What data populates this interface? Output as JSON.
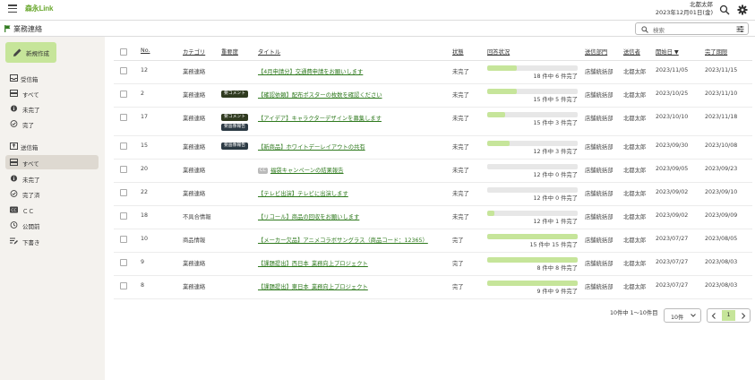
{
  "header": {
    "logo": "森永Link",
    "user_name": "北都太郎",
    "date": "2023年12月01日(金)"
  },
  "title_bar": {
    "title": "業務連絡",
    "search_placeholder": "検索"
  },
  "sidebar": {
    "new_button": "新規作成",
    "received": {
      "label": "受信箱",
      "items": [
        "すべて",
        "未完了",
        "完了"
      ]
    },
    "sent": {
      "label": "送信箱",
      "items": [
        "すべて",
        "未完了",
        "完了済",
        "ＣＣ",
        "公開前",
        "下書き"
      ]
    }
  },
  "table": {
    "headers": [
      "No.",
      "カテゴリ",
      "重要度",
      "タイトル",
      "状態",
      "回答状況",
      "送信部門",
      "送信者",
      "開始日 ▼",
      "完了期限"
    ],
    "rows": [
      {
        "no": "12",
        "category": "業務連絡",
        "badges": [],
        "cc": false,
        "title": "【4月申請分】交通費申請をお願いします",
        "status": "未完了",
        "progress_text": "18 件中 6 件完了",
        "progress": 0.33,
        "dept": "店舗統括部",
        "sender": "北都太郎",
        "start": "2023/11/05",
        "due": "2023/11/15"
      },
      {
        "no": "2",
        "category": "業務連絡",
        "badges": [
          "要コメント"
        ],
        "cc": false,
        "title": "【確認依頼】配布ポスターの枚数を確認ください",
        "status": "未完了",
        "progress_text": "15 件中 5 件完了",
        "progress": 0.33,
        "dept": "店舗統括部",
        "sender": "北都太郎",
        "start": "2023/10/25",
        "due": "2023/11/10"
      },
      {
        "no": "17",
        "category": "業務連絡",
        "badges": [
          "要コメント",
          "要画像報告"
        ],
        "cc": false,
        "title": "【アイデア】キャラクターデザインを募集します",
        "status": "未完了",
        "progress_text": "15 件中 3 件完了",
        "progress": 0.2,
        "dept": "店舗統括部",
        "sender": "北都太郎",
        "start": "2023/10/10",
        "due": "2023/11/18"
      },
      {
        "no": "15",
        "category": "業務連絡",
        "badges": [
          "要画像報告"
        ],
        "cc": false,
        "title": "【新商品】ホワイトデーレイアウトの共有",
        "status": "未完了",
        "progress_text": "12 件中 3 件完了",
        "progress": 0.25,
        "dept": "店舗統括部",
        "sender": "北都太郎",
        "start": "2023/09/30",
        "due": "2023/10/08"
      },
      {
        "no": "20",
        "category": "業務連絡",
        "badges": [],
        "cc": true,
        "title": "福袋キャンペーンの結果報告",
        "status": "未完了",
        "progress_text": "12 件中 0 件完了",
        "progress": 0.0,
        "dept": "店舗統括部",
        "sender": "北都太郎",
        "start": "2023/09/05",
        "due": "2023/09/23"
      },
      {
        "no": "22",
        "category": "業務連絡",
        "badges": [],
        "cc": false,
        "title": "【テレビ出演】テレビに出演します",
        "status": "未完了",
        "progress_text": "12 件中 0 件完了",
        "progress": 0.0,
        "dept": "店舗統括部",
        "sender": "北都太郎",
        "start": "2023/09/02",
        "due": "2023/09/10"
      },
      {
        "no": "18",
        "category": "不具合情報",
        "badges": [],
        "cc": false,
        "title": "【リコール】商品の回収をお願いします",
        "status": "未完了",
        "progress_text": "12 件中 1 件完了",
        "progress": 0.08,
        "dept": "店舗統括部",
        "sender": "北都太郎",
        "start": "2023/09/02",
        "due": "2023/09/09"
      },
      {
        "no": "10",
        "category": "商品情報",
        "badges": [],
        "cc": false,
        "title": "【メーカー欠品】アニメコラボサングラス（商品コード：12365）",
        "status": "完了",
        "progress_text": "15 件中 15 件完了",
        "progress": 1.0,
        "dept": "店舗統括部",
        "sender": "北都太郎",
        "start": "2023/07/27",
        "due": "2023/08/05"
      },
      {
        "no": "9",
        "category": "業務連絡",
        "badges": [],
        "cc": false,
        "title": "【課題提出】西日本_業務向上プロジェクト",
        "status": "完了",
        "progress_text": "8 件中 8 件完了",
        "progress": 1.0,
        "dept": "店舗統括部",
        "sender": "北都太郎",
        "start": "2023/07/27",
        "due": "2023/08/03"
      },
      {
        "no": "8",
        "category": "業務連絡",
        "badges": [],
        "cc": false,
        "title": "【課題提出】東日本_業務向上プロジェクト",
        "status": "完了",
        "progress_text": "9 件中 9 件完了",
        "progress": 1.0,
        "dept": "店舗統括部",
        "sender": "北都太郎",
        "start": "2023/07/27",
        "due": "2023/08/03"
      }
    ]
  },
  "pagination": {
    "summary": "10件中 1〜10件目",
    "per_page": "10件",
    "current_page": "1"
  },
  "colors": {
    "accent": "#c6e59a",
    "link": "#2f7a1e",
    "sidebar_bg": "#f4f2ee"
  }
}
